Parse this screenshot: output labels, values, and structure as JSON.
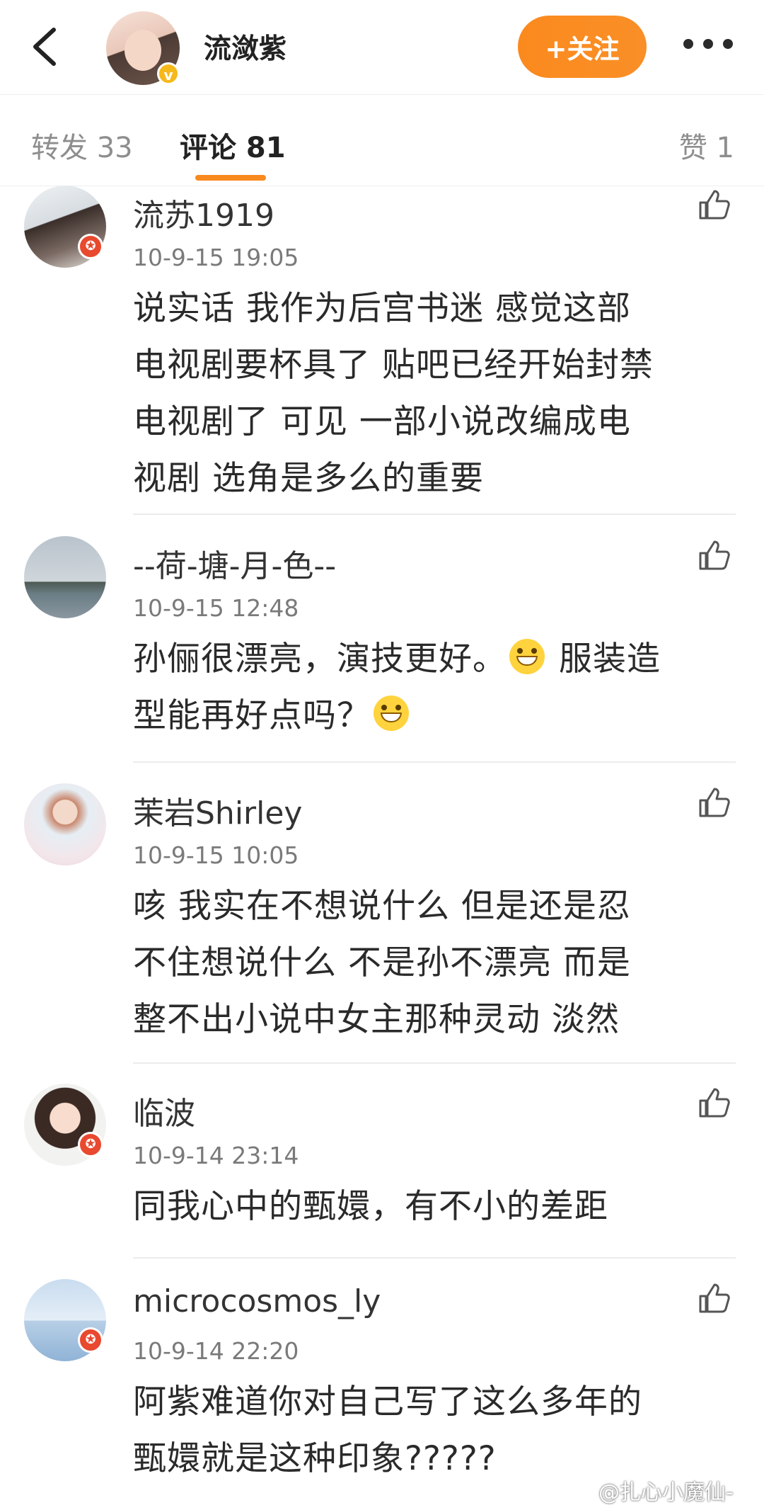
{
  "header": {
    "username": "流潋紫",
    "follow_label": "+关注",
    "verified_mark": "v"
  },
  "tabs": {
    "repost": "转发 33",
    "comment": "评论 81",
    "like": "赞 1"
  },
  "comments": [
    {
      "name": "流苏1919",
      "time": "10-9-15 19:05",
      "lines": [
        "说实话 我作为后宫书迷 感觉这部",
        "电视剧要杯具了 贴吧已经开始封禁",
        "电视剧了 可见 一部小说改编成电",
        "视剧 选角是多么的重要"
      ]
    },
    {
      "name": "--荷-塘-月-色--",
      "time": "10-9-15 12:48",
      "line1_a": "孙俪很漂亮，演技更好。",
      "line1_b": " 服装造",
      "line2": "型能再好点吗？"
    },
    {
      "name": "茉岩Shirley",
      "time": "10-9-15 10:05",
      "lines": [
        "咳 我实在不想说什么 但是还是忍",
        "不住想说什么  不是孙不漂亮  而是",
        "整不出小说中女主那种灵动 淡然"
      ]
    },
    {
      "name": "临波",
      "time": "10-9-14 23:14",
      "lines": [
        "同我心中的甄嬛，有不小的差距"
      ]
    },
    {
      "name": "microcosmos_ly",
      "time": "10-9-14 22:20",
      "lines": [
        "阿紫难道你对自己写了这么多年的",
        "甄嬛就是这种印象?????"
      ]
    }
  ],
  "watermark": "@扎心小魔仙-",
  "icons": [
    "back-arrow-icon",
    "more-dots-icon",
    "thumbs-up-icon",
    "emoji-grin-icon",
    "verified-badge-icon",
    "member-badge-icon"
  ],
  "colors": {
    "accent": "#f88a1e",
    "badge_red": "#e8492f",
    "verified": "#f6b91c"
  }
}
